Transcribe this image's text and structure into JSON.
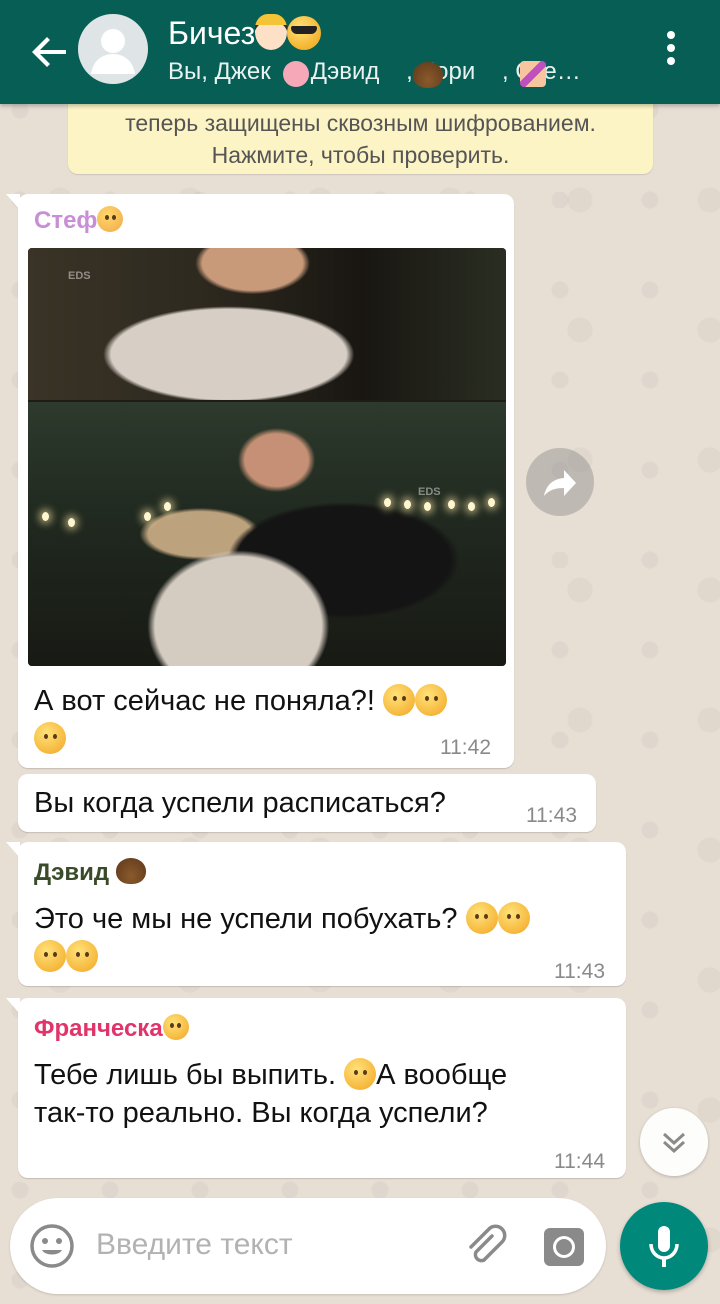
{
  "header": {
    "title": "Бичез",
    "subtitle": "Вы, Джек    , Дэвид    , Лори    , Сте…",
    "accent_color": "#075e54"
  },
  "notice": {
    "line1": "теперь защищены сквозным шифрованием.",
    "line2": "Нажмите, чтобы проверить."
  },
  "messages": [
    {
      "sender": "Стеф",
      "sender_color": "#c88fd6",
      "text": "А вот сейчас не поняла?!",
      "time": "11:42",
      "has_photo": true
    },
    {
      "sender": "",
      "text": "Вы когда успели расписаться?",
      "time": "11:43"
    },
    {
      "sender": "Дэвид",
      "sender_color": "#3a4b2a",
      "text": "Это че мы не успели побухать?",
      "time": "11:43"
    },
    {
      "sender": "Франческа",
      "sender_color": "#e0346a",
      "text_line1": "Тебе лишь бы выпить.",
      "text_line1b": "А вообще",
      "text_line2": "так-то реально. Вы когда успели?",
      "time": "11:44"
    }
  ],
  "photo": {
    "watermark1": "EDS",
    "watermark2": "EDS"
  },
  "input": {
    "placeholder": "Введите текст"
  },
  "icons": {
    "back": "arrow-left-icon",
    "menu": "more-vertical-icon",
    "forward": "share-forward-icon",
    "scroll_down": "chevron-double-down-icon",
    "emoji": "smiley-icon",
    "attach": "paperclip-icon",
    "camera": "camera-icon",
    "mic": "microphone-icon"
  }
}
